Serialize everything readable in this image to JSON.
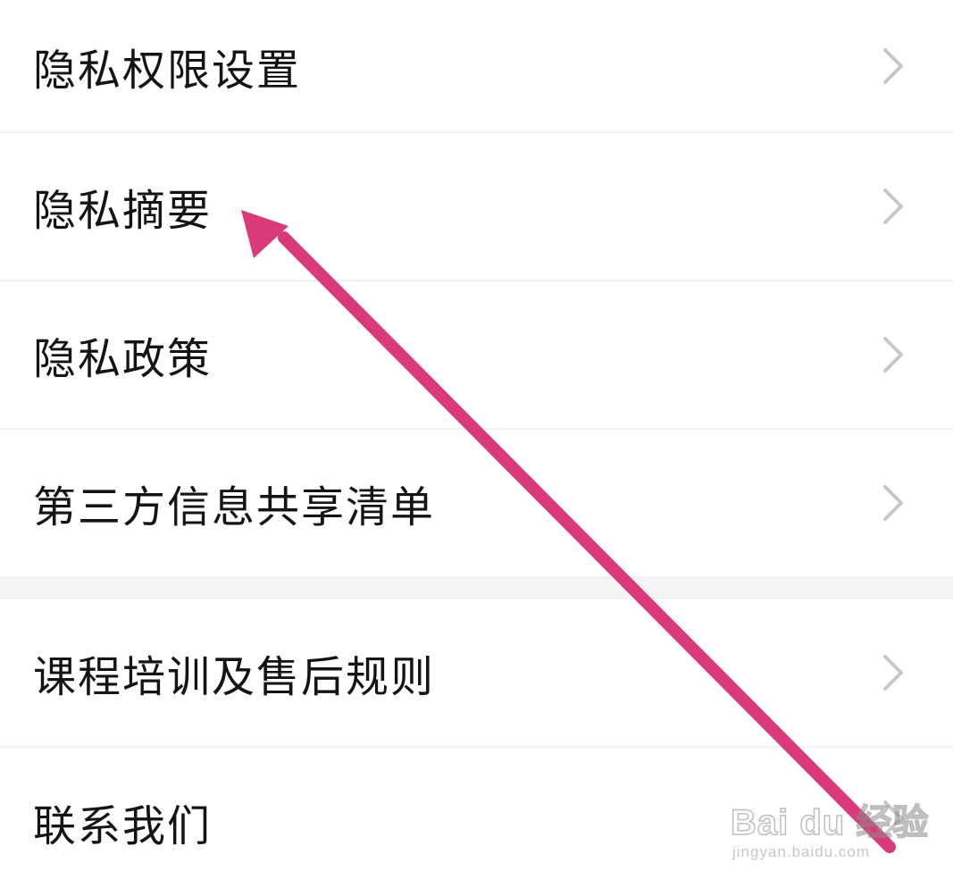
{
  "menu": {
    "items": [
      {
        "label": "隐私权限设置"
      },
      {
        "label": "隐私摘要"
      },
      {
        "label": "隐私政策"
      },
      {
        "label": "第三方信息共享清单"
      },
      {
        "label": "课程培训及售后规则"
      },
      {
        "label": "联系我们"
      }
    ]
  },
  "annotation": {
    "arrow_color": "#db3a7a"
  },
  "watermark": {
    "brand": "Bai du 经验",
    "url": "jingyan.baidu.com"
  },
  "icons": {
    "row_chevron": "chevron-right-icon"
  }
}
